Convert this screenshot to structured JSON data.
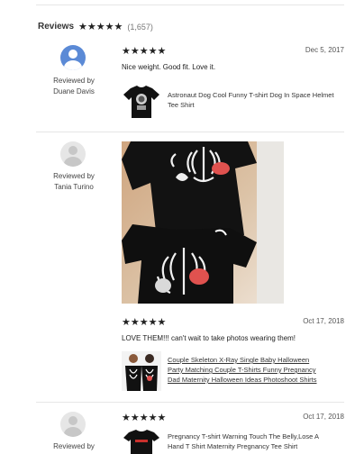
{
  "header": {
    "title": "Reviews",
    "stars": "★★★★★",
    "count": "(1,657)"
  },
  "reviews": [
    {
      "reviewer_line1": "Reviewed by",
      "reviewer_name": "Duane Davis",
      "stars": "★★★★★",
      "date": "Dec 5, 2017",
      "text": "Nice weight. Good fit. Love it.",
      "product_title": "Astronaut Dog Cool Funny T-shirt Dog In Space Helmet Tee Shirt",
      "avatar_color": "#5b8ad6"
    },
    {
      "reviewer_line1": "Reviewed by",
      "reviewer_name": "Tania Turino",
      "stars": "★★★★★",
      "date": "Oct 17, 2018",
      "text": "LOVE THEM!!! can't wait to take photos wearing them!",
      "product_title_lines": [
        "Couple Skeleton X-Ray Single Baby Halloween",
        "Party Matching Couple T-Shirts Funny Pregnancy",
        "Dad Maternity Halloween Ideas Photoshoot Shirts"
      ]
    },
    {
      "reviewer_line1": "Reviewed by",
      "stars": "★★★★★",
      "date": "Oct 17, 2018",
      "product_title_lines": [
        "Pregnancy T-shirt Warning Touch The Belly,Lose A",
        "Hand T Shirt Maternity Pregnancy Tee Shirt"
      ]
    }
  ],
  "icons": {
    "star": "star-icon",
    "avatar": "user-avatar-icon"
  }
}
